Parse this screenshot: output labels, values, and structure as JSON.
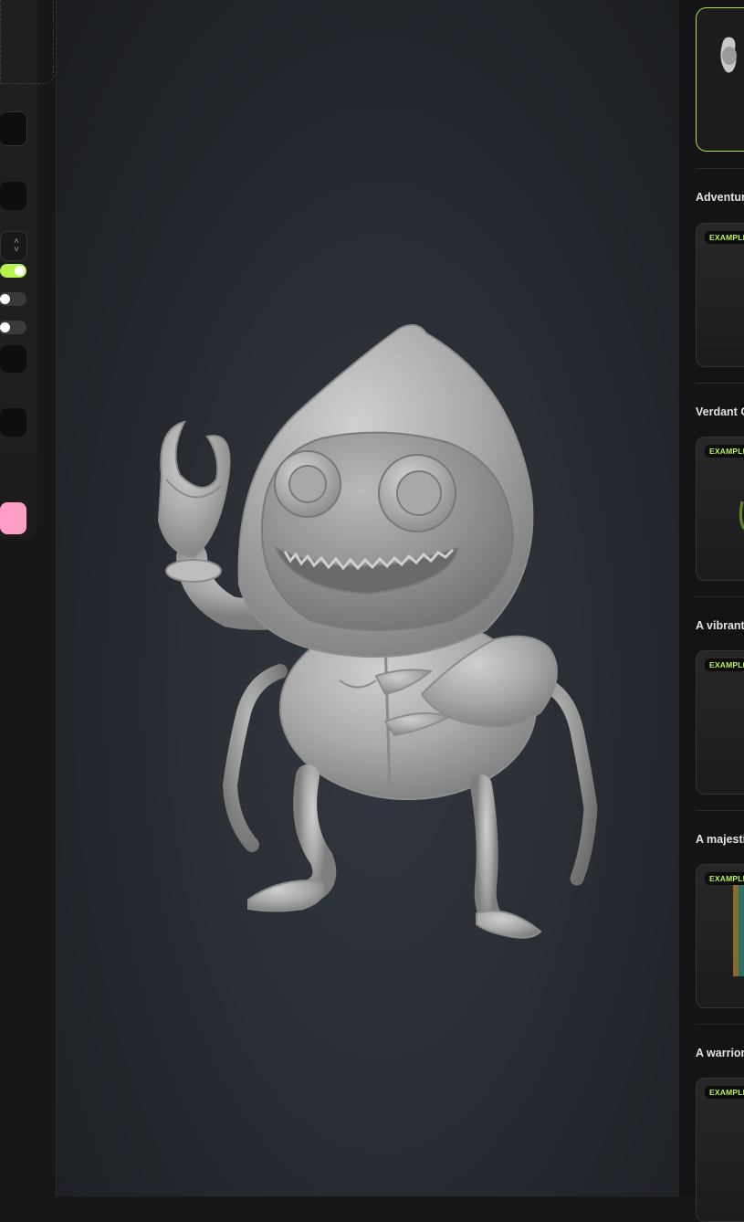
{
  "settings_panel": {
    "toggles": [
      {
        "name": "toggle-1",
        "state": "on"
      },
      {
        "name": "toggle-2",
        "state": "off"
      },
      {
        "name": "toggle-3",
        "state": "off"
      }
    ],
    "generate_button_color": "#ff9ec7"
  },
  "viewport": {
    "model_icon": "hooded-crab-creature-model"
  },
  "gallery": {
    "accent_color": "#a6e34a",
    "cards": [
      {
        "title": "Adventur",
        "badge": "EXAMPLE"
      },
      {
        "title": "Verdant C",
        "badge": "EXAMPLE"
      },
      {
        "title": "A vibrant",
        "badge": "EXAMPLE"
      },
      {
        "title": "A majesti",
        "badge": "EXAMPLE"
      },
      {
        "title": "A warrior",
        "badge": "EXAMPLE"
      }
    ]
  }
}
